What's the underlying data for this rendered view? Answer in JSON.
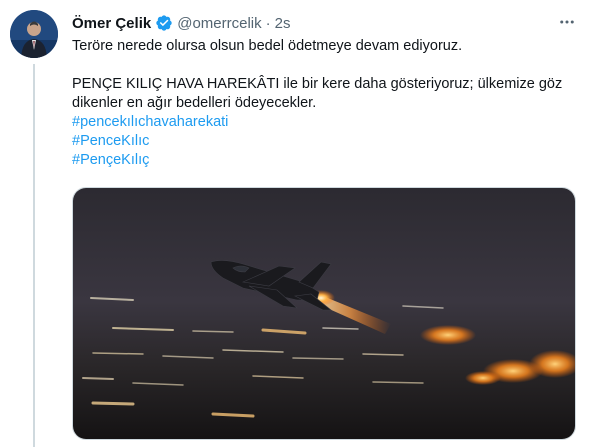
{
  "tweet": {
    "author_name": "Ömer Çelik",
    "handle": "@omerrcelik",
    "separator": "·",
    "time": "2s",
    "line1": "Teröre nerede olursa olsun bedel ödetmeye devam ediyoruz.",
    "line2": "PENÇE KILIÇ HAVA HAREKÂTI ile bir kere daha gösteriyoruz; ülkemize göz dikenler en ağır bedelleri ödeyecekler.",
    "hashtags": [
      "#pencekılıchavaharekati",
      "#PenceKılıc",
      "#PençeKılıç"
    ]
  },
  "colors": {
    "link": "#1d9bf0",
    "verified": "#1d9bf0",
    "muted": "#536471"
  },
  "icons": {
    "verified": "verified-badge-icon",
    "more": "more-options-icon"
  }
}
